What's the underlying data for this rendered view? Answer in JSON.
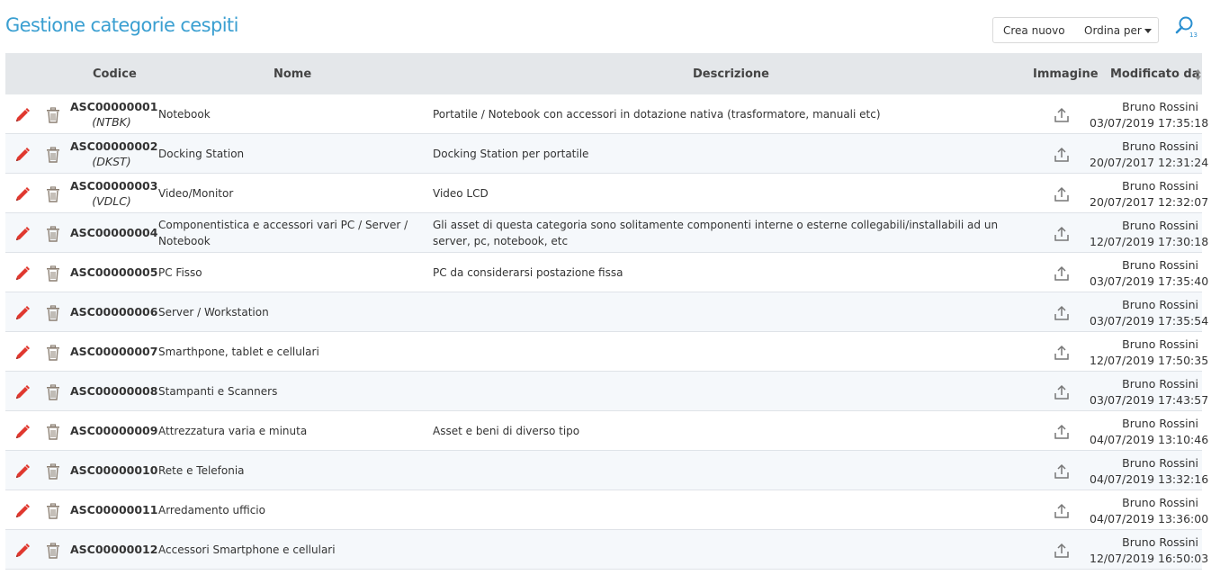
{
  "page": {
    "title": "Gestione categorie cespiti"
  },
  "toolbar": {
    "create_label": "Crea nuovo",
    "order_label": "Ordina per"
  },
  "table": {
    "headers": {
      "codice": "Codice",
      "nome": "Nome",
      "descrizione": "Descrizione",
      "immagine": "Immagine",
      "modificato": "Modificato da"
    },
    "rows": [
      {
        "code": "ASC00000001",
        "abbr": "(NTBK)",
        "name": "Notebook",
        "description": "Portatile / Notebook con accessori in dotazione nativa (trasformatore, manuali etc)",
        "user": "Bruno Rossini",
        "date": "03/07/2019 17:35:18"
      },
      {
        "code": "ASC00000002",
        "abbr": "(DKST)",
        "name": "Docking Station",
        "description": "Docking Station per portatile",
        "user": "Bruno Rossini",
        "date": "20/07/2017 12:31:24"
      },
      {
        "code": "ASC00000003",
        "abbr": "(VDLC)",
        "name": "Video/Monitor",
        "description": "Video LCD",
        "user": "Bruno Rossini",
        "date": "20/07/2017 12:32:07"
      },
      {
        "code": "ASC00000004",
        "abbr": "",
        "name": "Componentistica e accessori vari PC / Server / Notebook",
        "description": "Gli asset di questa categoria sono solitamente componenti interne o esterne collegabili/installabili ad un server, pc, notebook, etc",
        "user": "Bruno Rossini",
        "date": "12/07/2019 17:30:18"
      },
      {
        "code": "ASC00000005",
        "abbr": "",
        "name": "PC Fisso",
        "description": "PC da considerarsi postazione fissa",
        "user": "Bruno Rossini",
        "date": "03/07/2019 17:35:40"
      },
      {
        "code": "ASC00000006",
        "abbr": "",
        "name": "Server / Workstation",
        "description": "",
        "user": "Bruno Rossini",
        "date": "03/07/2019 17:35:54"
      },
      {
        "code": "ASC00000007",
        "abbr": "",
        "name": "Smarthpone, tablet e cellulari",
        "description": "",
        "user": "Bruno Rossini",
        "date": "12/07/2019 17:50:35"
      },
      {
        "code": "ASC00000008",
        "abbr": "",
        "name": "Stampanti e Scanners",
        "description": "",
        "user": "Bruno Rossini",
        "date": "03/07/2019 17:43:57"
      },
      {
        "code": "ASC00000009",
        "abbr": "",
        "name": "Attrezzatura varia e minuta",
        "description": "Asset e beni di diverso tipo",
        "user": "Bruno Rossini",
        "date": "04/07/2019 13:10:46"
      },
      {
        "code": "ASC00000010",
        "abbr": "",
        "name": "Rete e Telefonia",
        "description": "",
        "user": "Bruno Rossini",
        "date": "04/07/2019 13:32:16"
      },
      {
        "code": "ASC00000011",
        "abbr": "",
        "name": "Arredamento ufficio",
        "description": "",
        "user": "Bruno Rossini",
        "date": "04/07/2019 13:36:00"
      },
      {
        "code": "ASC00000012",
        "abbr": "",
        "name": "Accessori Smartphone e cellulari",
        "description": "",
        "user": "Bruno Rossini",
        "date": "12/07/2019 16:50:03"
      }
    ]
  },
  "icons": {
    "edit": "pencil-icon",
    "delete": "trash-icon",
    "image": "upload-icon",
    "search": "search-icon",
    "sort": "sort-icon",
    "dropdown": "chevron-down-icon"
  },
  "colors": {
    "title": "#3a9fd1",
    "edit_icon": "#e0382f",
    "header_bg": "#e4e7ea",
    "alt_row_bg": "#f5f8fb"
  }
}
